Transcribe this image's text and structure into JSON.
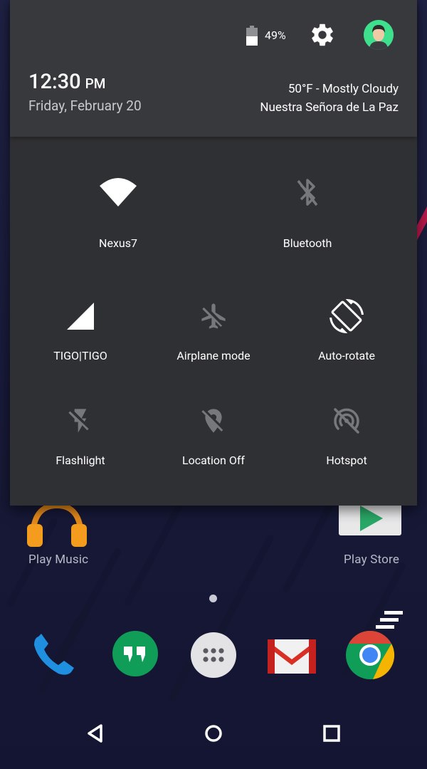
{
  "status": {
    "battery_percent": "49%",
    "battery_level": 0.49
  },
  "header": {
    "time": "12:30",
    "ampm": "PM",
    "date": "Friday, February 20",
    "weather": "50°F - Mostly Cloudy",
    "location": "Nuestra Señora de La Paz"
  },
  "tiles": {
    "wifi": "Nexus7",
    "bluetooth": "Bluetooth",
    "cellular": "TIGO|TIGO",
    "airplane": "Airplane mode",
    "rotate": "Auto-rotate",
    "flashlight": "Flashlight",
    "location": "Location Off",
    "hotspot": "Hotspot"
  },
  "home": {
    "apps": [
      "Play Music",
      "Play Store"
    ],
    "dock": [
      "Phone",
      "Hangouts",
      "App drawer",
      "Gmail",
      "Chrome"
    ]
  },
  "colors": {
    "panel": "#2f3033",
    "header": "#38393c",
    "tile_on": "#ffffff",
    "tile_off": "#77787b",
    "avatar": "#3ee08d"
  }
}
